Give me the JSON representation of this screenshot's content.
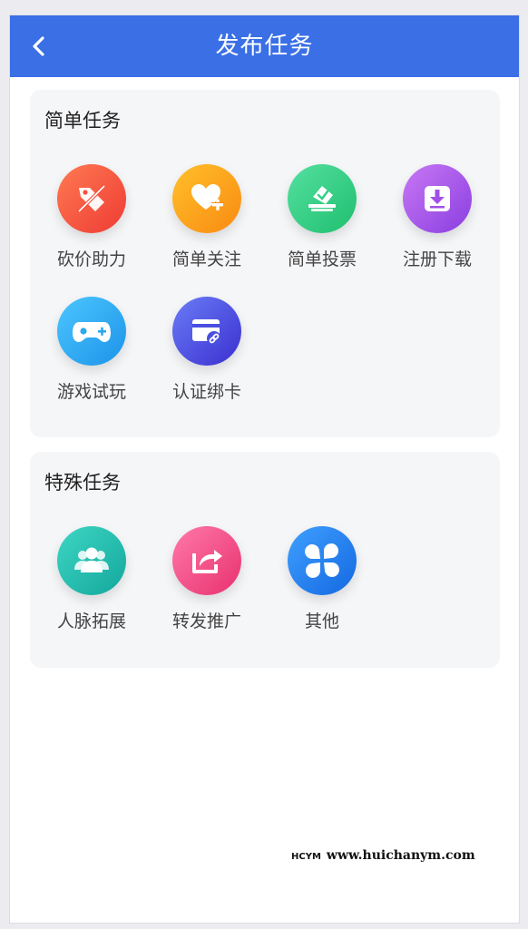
{
  "header": {
    "title": "发布任务",
    "back_icon": "chevron-left-icon"
  },
  "sections": {
    "simple": {
      "title": "简单任务",
      "items": [
        {
          "label": "砍价助力",
          "icon": "price-tag-cut-icon",
          "color": "#f44d3e"
        },
        {
          "label": "简单关注",
          "icon": "heart-plus-icon",
          "color": "#fb9b1a"
        },
        {
          "label": "简单投票",
          "icon": "ballot-box-icon",
          "color": "#2fcf82"
        },
        {
          "label": "注册下载",
          "icon": "download-icon",
          "color": "#a050e6"
        },
        {
          "label": "游戏试玩",
          "icon": "gamepad-icon",
          "color": "#2ba8f0"
        },
        {
          "label": "认证绑卡",
          "icon": "card-link-icon",
          "color": "#4a4fe0"
        }
      ]
    },
    "special": {
      "title": "特殊任务",
      "items": [
        {
          "label": "人脉拓展",
          "icon": "people-icon",
          "color": "#1fbcb0"
        },
        {
          "label": "转发推广",
          "icon": "share-icon",
          "color": "#f24c8a"
        },
        {
          "label": "其他",
          "icon": "four-petal-icon",
          "color": "#1e7ef0"
        }
      ]
    }
  },
  "watermark": {
    "logo": "HCYM",
    "text": "www.huichanym.com"
  }
}
